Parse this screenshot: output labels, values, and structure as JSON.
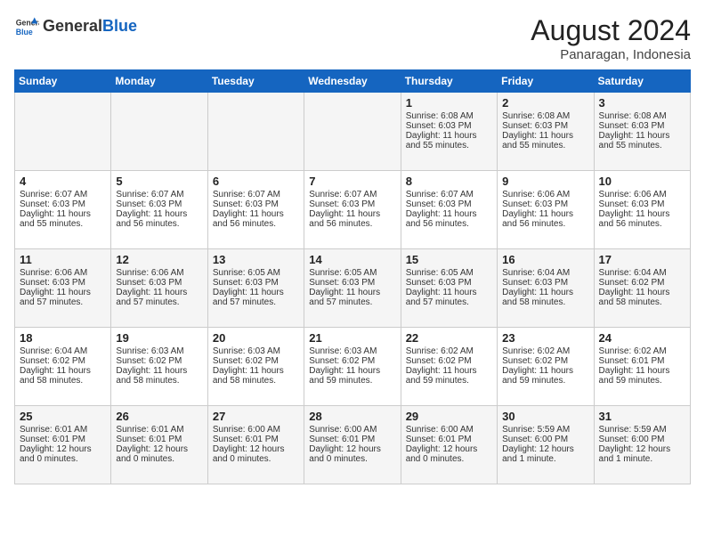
{
  "header": {
    "logo_general": "General",
    "logo_blue": "Blue",
    "month_year": "August 2024",
    "location": "Panaragan, Indonesia"
  },
  "days_of_week": [
    "Sunday",
    "Monday",
    "Tuesday",
    "Wednesday",
    "Thursday",
    "Friday",
    "Saturday"
  ],
  "weeks": [
    [
      {
        "day": "",
        "info": ""
      },
      {
        "day": "",
        "info": ""
      },
      {
        "day": "",
        "info": ""
      },
      {
        "day": "",
        "info": ""
      },
      {
        "day": "1",
        "info": "Sunrise: 6:08 AM\nSunset: 6:03 PM\nDaylight: 11 hours\nand 55 minutes."
      },
      {
        "day": "2",
        "info": "Sunrise: 6:08 AM\nSunset: 6:03 PM\nDaylight: 11 hours\nand 55 minutes."
      },
      {
        "day": "3",
        "info": "Sunrise: 6:08 AM\nSunset: 6:03 PM\nDaylight: 11 hours\nand 55 minutes."
      }
    ],
    [
      {
        "day": "4",
        "info": "Sunrise: 6:07 AM\nSunset: 6:03 PM\nDaylight: 11 hours\nand 55 minutes."
      },
      {
        "day": "5",
        "info": "Sunrise: 6:07 AM\nSunset: 6:03 PM\nDaylight: 11 hours\nand 56 minutes."
      },
      {
        "day": "6",
        "info": "Sunrise: 6:07 AM\nSunset: 6:03 PM\nDaylight: 11 hours\nand 56 minutes."
      },
      {
        "day": "7",
        "info": "Sunrise: 6:07 AM\nSunset: 6:03 PM\nDaylight: 11 hours\nand 56 minutes."
      },
      {
        "day": "8",
        "info": "Sunrise: 6:07 AM\nSunset: 6:03 PM\nDaylight: 11 hours\nand 56 minutes."
      },
      {
        "day": "9",
        "info": "Sunrise: 6:06 AM\nSunset: 6:03 PM\nDaylight: 11 hours\nand 56 minutes."
      },
      {
        "day": "10",
        "info": "Sunrise: 6:06 AM\nSunset: 6:03 PM\nDaylight: 11 hours\nand 56 minutes."
      }
    ],
    [
      {
        "day": "11",
        "info": "Sunrise: 6:06 AM\nSunset: 6:03 PM\nDaylight: 11 hours\nand 57 minutes."
      },
      {
        "day": "12",
        "info": "Sunrise: 6:06 AM\nSunset: 6:03 PM\nDaylight: 11 hours\nand 57 minutes."
      },
      {
        "day": "13",
        "info": "Sunrise: 6:05 AM\nSunset: 6:03 PM\nDaylight: 11 hours\nand 57 minutes."
      },
      {
        "day": "14",
        "info": "Sunrise: 6:05 AM\nSunset: 6:03 PM\nDaylight: 11 hours\nand 57 minutes."
      },
      {
        "day": "15",
        "info": "Sunrise: 6:05 AM\nSunset: 6:03 PM\nDaylight: 11 hours\nand 57 minutes."
      },
      {
        "day": "16",
        "info": "Sunrise: 6:04 AM\nSunset: 6:03 PM\nDaylight: 11 hours\nand 58 minutes."
      },
      {
        "day": "17",
        "info": "Sunrise: 6:04 AM\nSunset: 6:02 PM\nDaylight: 11 hours\nand 58 minutes."
      }
    ],
    [
      {
        "day": "18",
        "info": "Sunrise: 6:04 AM\nSunset: 6:02 PM\nDaylight: 11 hours\nand 58 minutes."
      },
      {
        "day": "19",
        "info": "Sunrise: 6:03 AM\nSunset: 6:02 PM\nDaylight: 11 hours\nand 58 minutes."
      },
      {
        "day": "20",
        "info": "Sunrise: 6:03 AM\nSunset: 6:02 PM\nDaylight: 11 hours\nand 58 minutes."
      },
      {
        "day": "21",
        "info": "Sunrise: 6:03 AM\nSunset: 6:02 PM\nDaylight: 11 hours\nand 59 minutes."
      },
      {
        "day": "22",
        "info": "Sunrise: 6:02 AM\nSunset: 6:02 PM\nDaylight: 11 hours\nand 59 minutes."
      },
      {
        "day": "23",
        "info": "Sunrise: 6:02 AM\nSunset: 6:02 PM\nDaylight: 11 hours\nand 59 minutes."
      },
      {
        "day": "24",
        "info": "Sunrise: 6:02 AM\nSunset: 6:01 PM\nDaylight: 11 hours\nand 59 minutes."
      }
    ],
    [
      {
        "day": "25",
        "info": "Sunrise: 6:01 AM\nSunset: 6:01 PM\nDaylight: 12 hours\nand 0 minutes."
      },
      {
        "day": "26",
        "info": "Sunrise: 6:01 AM\nSunset: 6:01 PM\nDaylight: 12 hours\nand 0 minutes."
      },
      {
        "day": "27",
        "info": "Sunrise: 6:00 AM\nSunset: 6:01 PM\nDaylight: 12 hours\nand 0 minutes."
      },
      {
        "day": "28",
        "info": "Sunrise: 6:00 AM\nSunset: 6:01 PM\nDaylight: 12 hours\nand 0 minutes."
      },
      {
        "day": "29",
        "info": "Sunrise: 6:00 AM\nSunset: 6:01 PM\nDaylight: 12 hours\nand 0 minutes."
      },
      {
        "day": "30",
        "info": "Sunrise: 5:59 AM\nSunset: 6:00 PM\nDaylight: 12 hours\nand 1 minute."
      },
      {
        "day": "31",
        "info": "Sunrise: 5:59 AM\nSunset: 6:00 PM\nDaylight: 12 hours\nand 1 minute."
      }
    ]
  ]
}
